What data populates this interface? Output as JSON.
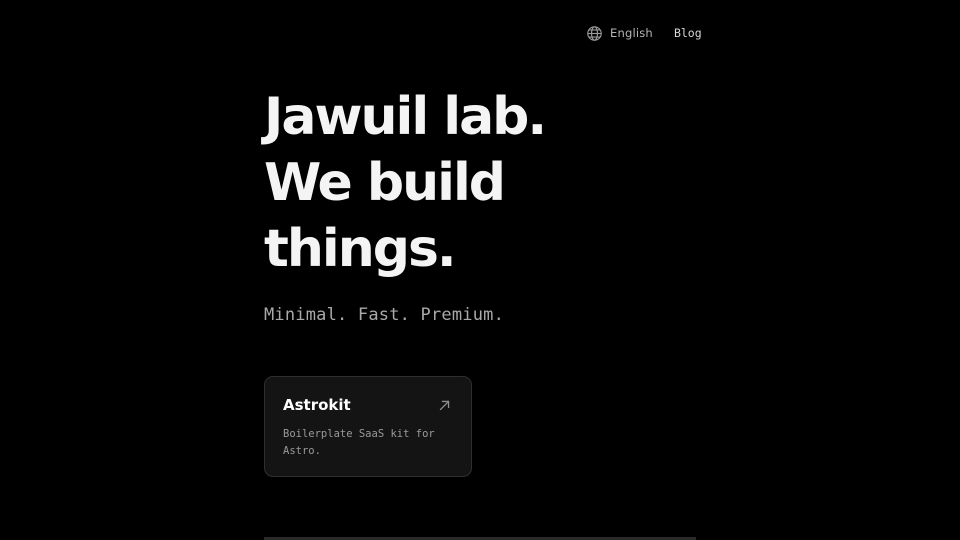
{
  "header": {
    "language_label": "English",
    "language_icon": "globe-icon",
    "blog_label": "Blog"
  },
  "hero": {
    "lines": [
      "Jawuil lab.",
      "We build",
      "things."
    ],
    "tagline": "Minimal. Fast. Premium."
  },
  "projects": [
    {
      "title": "Astrokit",
      "description": "Boilerplate SaaS kit for Astro.",
      "icon": "arrow-up-right-icon"
    }
  ],
  "colors": {
    "background": "#000000",
    "heading": "#f4f4f4",
    "muted": "#a9a9a9",
    "card_bg": "#141414",
    "card_border": "#2f2f2f"
  }
}
